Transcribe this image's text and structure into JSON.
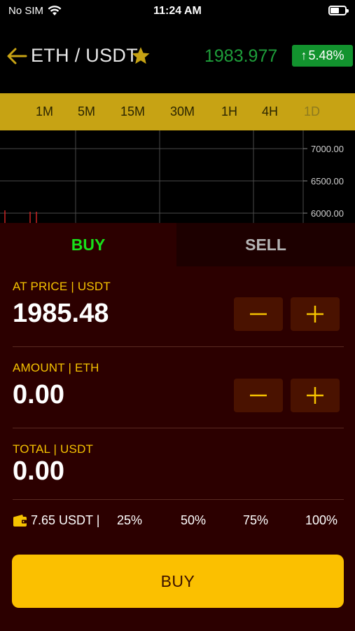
{
  "status_bar": {
    "carrier": "No SIM",
    "time": "11:24 AM"
  },
  "header": {
    "pair": "ETH / USDT",
    "last_price": "1983.977",
    "change": "5.48%",
    "change_arrow": "↑"
  },
  "timeframes": [
    "1M",
    "5M",
    "15M",
    "30M",
    "1H",
    "4H",
    "1D"
  ],
  "chart": {
    "price_levels": [
      "7000.00",
      "6500.00",
      "6000.00"
    ]
  },
  "tabs": {
    "buy": "BUY",
    "sell": "SELL",
    "active": "BUY"
  },
  "form": {
    "price_label": "AT PRICE | USDT",
    "price_value": "1985.48",
    "amount_label": "AMOUNT | ETH",
    "amount_value": "0.00",
    "total_label": "TOTAL | USDT",
    "total_value": "0.00"
  },
  "balance": {
    "text": "7.65 USDT  |",
    "percentages": [
      "25%",
      "50%",
      "75%",
      "100%"
    ]
  },
  "action": {
    "buy_label": "BUY"
  },
  "colors": {
    "accent_gold": "#fbc000",
    "timeframe_bar": "#c7a314",
    "positive_green": "#1e9e3a",
    "panel_bg": "#2c0000",
    "stepper_bg": "#4a1200"
  },
  "icons": {
    "back": "back-arrow-icon",
    "favorite": "star-icon",
    "wallet": "wallet-icon",
    "minus": "minus-icon",
    "plus": "plus-icon"
  }
}
